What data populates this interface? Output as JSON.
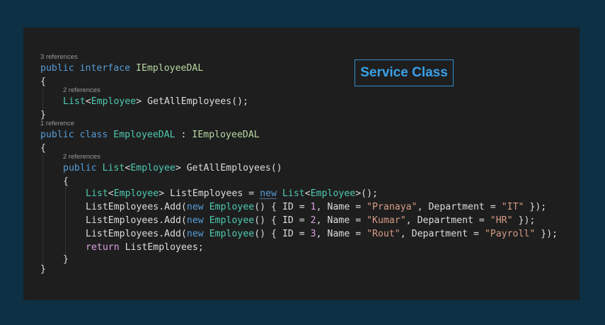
{
  "caption": "Service Class",
  "refs": {
    "interface_refs": "3 references",
    "interface_method_refs": "2 references",
    "class_refs": "1 reference",
    "class_method_refs": "2 references"
  },
  "code": {
    "kw_public": "public",
    "kw_interface": "interface",
    "kw_class": "class",
    "kw_new": "new",
    "kw_return": "return",
    "interface_name": "IEmployeeDAL",
    "class_name": "EmployeeDAL",
    "type_list": "List",
    "type_employee": "Employee",
    "method_name": "GetAllEmployees",
    "var_name": "ListEmployees",
    "add_method": ".Add(",
    "prop_id": "ID",
    "prop_name": "Name",
    "prop_dept": "Department",
    "rows": [
      {
        "id": "1",
        "name": "\"Pranaya\"",
        "dept": "\"IT\""
      },
      {
        "id": "2",
        "name": "\"Kumar\"",
        "dept": "\"HR\""
      },
      {
        "id": "3",
        "name": "\"Rout\"",
        "dept": "\"Payroll\""
      }
    ]
  }
}
